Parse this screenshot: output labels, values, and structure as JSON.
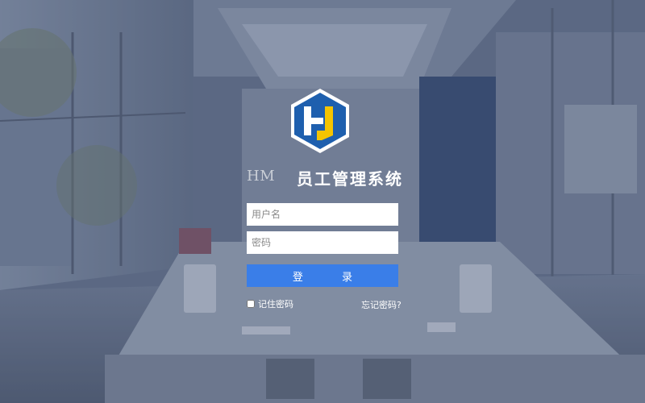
{
  "login": {
    "brand": "HM",
    "system_name": "员工管理系统",
    "username_placeholder": "用户名",
    "password_placeholder": "密码",
    "submit_label": "登 录",
    "remember_label": "记住密码",
    "forgot_label": "忘记密码?"
  },
  "colors": {
    "button": "#3a7ee8",
    "logo_blue": "#1e5fae",
    "logo_yellow": "#f5c400"
  }
}
